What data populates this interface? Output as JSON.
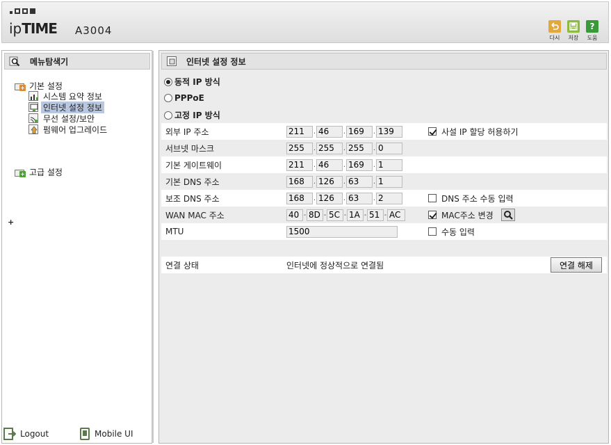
{
  "header": {
    "brand_ip": "ip",
    "brand_time": "TIME",
    "model": "A3004",
    "buttons": [
      {
        "label": "다시",
        "icon": "undo-icon",
        "color": "#e3a83b"
      },
      {
        "label": "저장",
        "icon": "save-icon",
        "color": "#8dbb3e"
      },
      {
        "label": "도움",
        "icon": "help-icon",
        "color": "#3a9a3a"
      }
    ],
    "help_glyph": "?"
  },
  "left": {
    "title": "메뉴탐색기",
    "basic": "기본 설정",
    "items": [
      "시스템 요약 정보",
      "인터넷 설정 정보",
      "무선 설정/보안",
      "펌웨어 업그레이드"
    ],
    "active_index": 1,
    "advanced": "고급 설정",
    "expand": "+",
    "logout": "Logout",
    "mobile": "Mobile UI"
  },
  "right": {
    "title": "인터넷 설정 정보",
    "modes": [
      "동적 IP 방식",
      "PPPoE",
      "고정 IP 방식"
    ],
    "selected_mode": 0,
    "rows": {
      "ext_ip": {
        "label": "외부 IP 주소",
        "values": [
          "211",
          "46",
          "169",
          "139"
        ]
      },
      "subnet": {
        "label": "서브넷 마스크",
        "values": [
          "255",
          "255",
          "255",
          "0"
        ]
      },
      "gateway": {
        "label": "기본 게이트웨이",
        "values": [
          "211",
          "46",
          "169",
          "1"
        ]
      },
      "dns1": {
        "label": "기본 DNS 주소",
        "values": [
          "168",
          "126",
          "63",
          "1"
        ]
      },
      "dns2": {
        "label": "보조 DNS 주소",
        "values": [
          "168",
          "126",
          "63",
          "2"
        ]
      },
      "mac": {
        "label": "WAN MAC 주소",
        "values": [
          "40",
          "8D",
          "5C",
          "1A",
          "51",
          "AC"
        ]
      },
      "mtu": {
        "label": "MTU",
        "value": "1500"
      }
    },
    "options": {
      "private_ip": {
        "label": "사설 IP 할당 허용하기",
        "checked": true
      },
      "dns_manual": {
        "label": "DNS 주소 수동 입력",
        "checked": false
      },
      "mac_change": {
        "label": "MAC주소 변경",
        "checked": true
      },
      "mtu_manual": {
        "label": "수동 입력",
        "checked": false
      }
    },
    "status_label": "연결 상태",
    "status_value": "인터넷에 정상적으로 연결됨",
    "disconnect": "연결 해제"
  }
}
